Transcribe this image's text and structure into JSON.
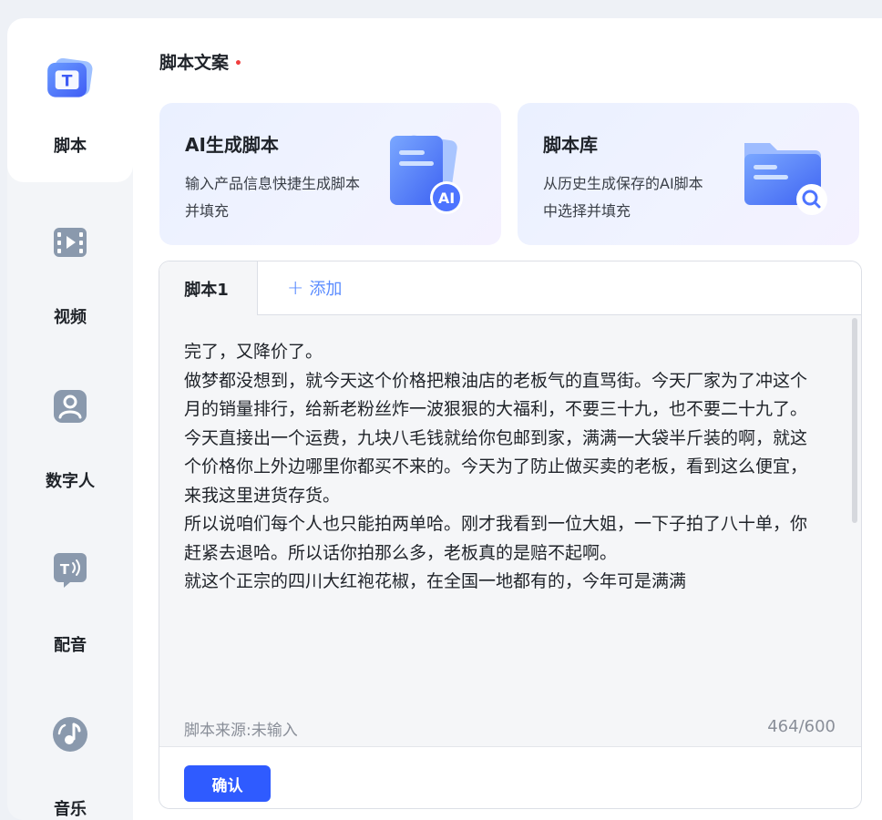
{
  "sidebar": {
    "items": [
      {
        "label": "脚本",
        "icon": "script-t-icon",
        "active": true
      },
      {
        "label": "视频",
        "icon": "video-icon",
        "active": false
      },
      {
        "label": "数字人",
        "icon": "avatar-face-icon",
        "active": false
      },
      {
        "label": "配音",
        "icon": "voiceover-icon",
        "active": false
      },
      {
        "label": "音乐",
        "icon": "music-note-icon",
        "active": false
      }
    ]
  },
  "main": {
    "section_title": "脚本文案",
    "required_mark": "•",
    "cards": [
      {
        "title": "AI生成脚本",
        "desc": "输入产品信息快捷生成脚本并填充",
        "icon": "ai-document-icon",
        "badge": "AI"
      },
      {
        "title": "脚本库",
        "desc": "从历史生成保存的AI脚本中选择并填充",
        "icon": "folder-search-icon"
      }
    ],
    "tabs": [
      {
        "label": "脚本1",
        "active": true
      }
    ],
    "add_tab_label": "添加",
    "script_text": "完了，又降价了。\n做梦都没想到，就今天这个价格把粮油店的老板气的直骂街。今天厂家为了冲这个月的销量排行，给新老粉丝炸一波狠狠的大福利，不要三十九，也不要二十九了。\n今天直接出一个运费，九块八毛钱就给你包邮到家，满满一大袋半斤装的啊，就这个价格你上外边哪里你都买不来的。今天为了防止做买卖的老板，看到这么便宜，来我这里进货存货。\n所以说咱们每个人也只能拍两单哈。刚才我看到一位大姐，一下子拍了八十单，你赶紧去退哈。所以话你拍那么多，老板真的是赔不起啊。\n就这个正宗的四川大红袍花椒，在全国一地都有的，今年可是满满",
    "source_label": "脚本来源:未输入",
    "char_count": "464/600",
    "confirm_label": "确认"
  },
  "colors": {
    "accent": "#2f5bff",
    "link": "#5b8cff",
    "required": "#f03e3e"
  }
}
